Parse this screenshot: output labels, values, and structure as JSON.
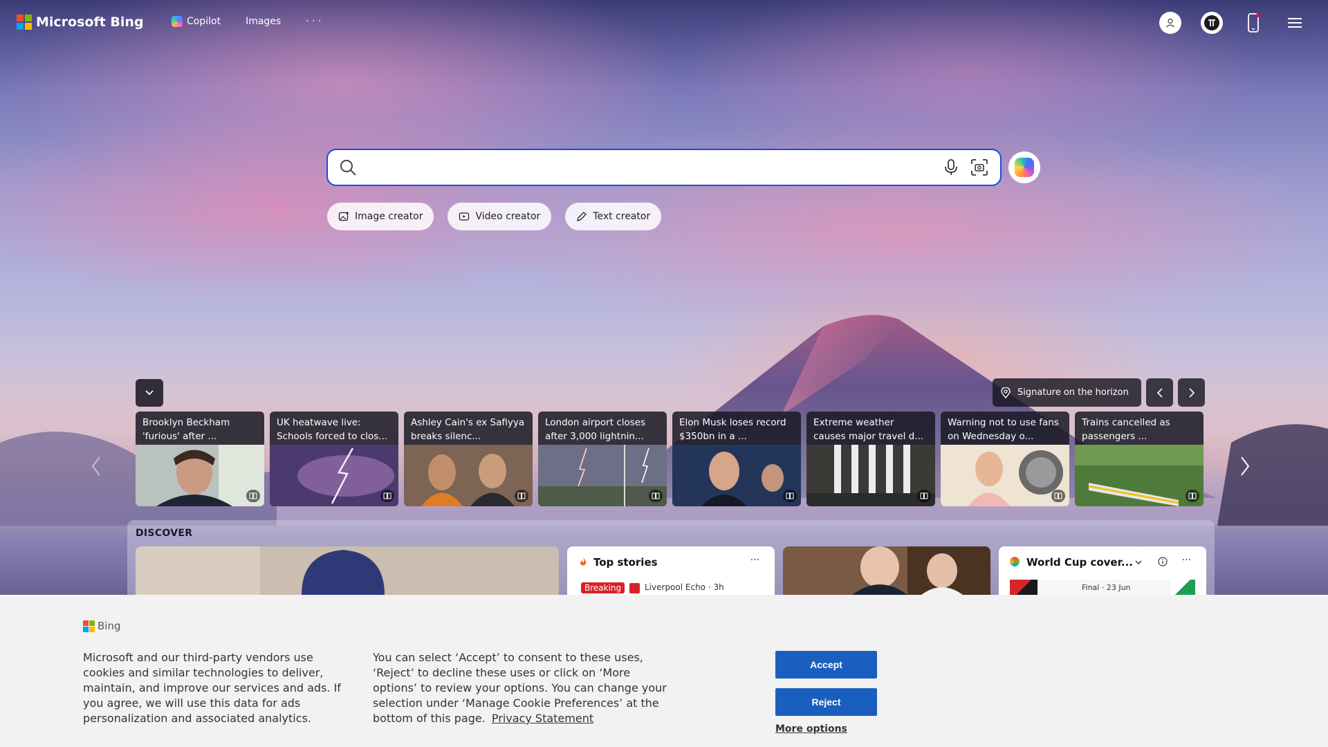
{
  "header": {
    "brand": "Microsoft Bing",
    "nav": [
      {
        "label": "Copilot",
        "icon": "copilot-icon"
      },
      {
        "label": "Images"
      },
      {
        "label": "· · ·"
      }
    ]
  },
  "search": {
    "placeholder": "",
    "value": ""
  },
  "creators": [
    {
      "label": "Image creator",
      "icon": "image-creator-icon"
    },
    {
      "label": "Video creator",
      "icon": "video-creator-icon"
    },
    {
      "label": "Text creator",
      "icon": "pen-icon"
    }
  ],
  "location": {
    "label": "Signature on the horizon"
  },
  "news": [
    {
      "title": "Brooklyn Beckham 'furious' after ..."
    },
    {
      "title": "UK heatwave live: Schools forced to clos..."
    },
    {
      "title": "Ashley Cain's ex Safiyya breaks silenc..."
    },
    {
      "title": "London airport closes after 3,000 lightnin..."
    },
    {
      "title": "Elon Musk loses record $350bn in a ..."
    },
    {
      "title": "Extreme weather causes major travel d..."
    },
    {
      "title": "Warning not to use fans on Wednesday o..."
    },
    {
      "title": "Trains cancelled as passengers ..."
    }
  ],
  "discover": {
    "title": "DISCOVER",
    "top_stories": {
      "title": "Top stories",
      "badge": "Breaking",
      "source": "Liverpool Echo · 3h",
      "more": "···"
    },
    "world_cup": {
      "title": "World Cup cover...",
      "meta": "Final · 23 Jun",
      "more": "···"
    }
  },
  "cookie": {
    "brand": "Bing",
    "text1": "Microsoft and our third-party vendors use cookies and similar technologies to deliver, maintain, and improve our services and ads. If you agree, we will use this data for ads personalization and associated analytics.",
    "text2": "You can select ‘Accept’ to consent to these uses, ‘Reject’ to decline these uses or click on ‘More options’ to review your options. You can change your selection under ‘Manage Cookie Preferences’ at the bottom of this page.",
    "privacy_link": "Privacy Statement",
    "accept": "Accept",
    "reject": "Reject",
    "more_options": "More options"
  },
  "colors": {
    "accent": "#174ae4",
    "button": "#1a5fbf",
    "breaking": "#d92024"
  }
}
